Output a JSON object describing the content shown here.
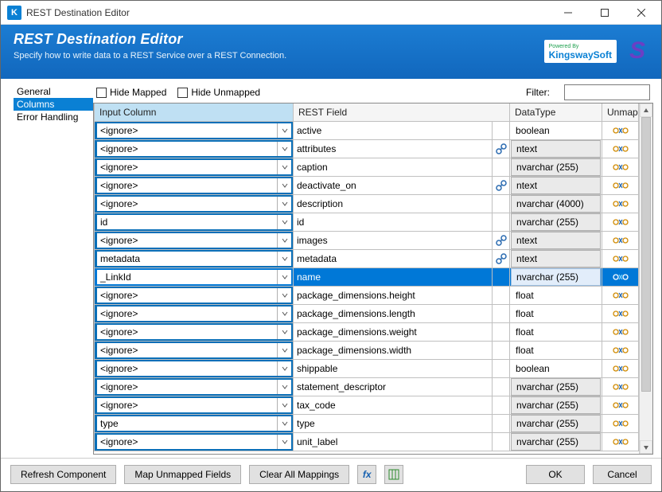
{
  "window": {
    "title": "REST Destination Editor"
  },
  "banner": {
    "heading": "REST Destination Editor",
    "subheading": "Specify how to write data to a REST Service over a REST Connection.",
    "powered_by_line1": "Powered By",
    "powered_by_line2": "KingswaySoft",
    "logo_s": "S"
  },
  "sidebar": {
    "items": [
      {
        "label": "General"
      },
      {
        "label": "Columns"
      },
      {
        "label": "Error Handling"
      }
    ],
    "selected_index": 1
  },
  "toolbar": {
    "hide_mapped": "Hide Mapped",
    "hide_unmapped": "Hide Unmapped",
    "filter_label": "Filter:"
  },
  "grid": {
    "headers": {
      "input": "Input Column",
      "rest": "REST Field",
      "datatype": "DataType",
      "unmap": "Unmap"
    },
    "rows": [
      {
        "input": "<ignore>",
        "rest": "active",
        "link": false,
        "datatype": "boolean",
        "dt_boxed": false
      },
      {
        "input": "<ignore>",
        "rest": "attributes",
        "link": true,
        "datatype": "ntext",
        "dt_boxed": true
      },
      {
        "input": "<ignore>",
        "rest": "caption",
        "link": false,
        "datatype": "nvarchar (255)",
        "dt_boxed": true
      },
      {
        "input": "<ignore>",
        "rest": "deactivate_on",
        "link": true,
        "datatype": "ntext",
        "dt_boxed": true
      },
      {
        "input": "<ignore>",
        "rest": "description",
        "link": false,
        "datatype": "nvarchar (4000)",
        "dt_boxed": true
      },
      {
        "input": "id",
        "rest": "id",
        "link": false,
        "datatype": "nvarchar (255)",
        "dt_boxed": true
      },
      {
        "input": "<ignore>",
        "rest": "images",
        "link": true,
        "datatype": "ntext",
        "dt_boxed": true
      },
      {
        "input": "metadata",
        "rest": "metadata",
        "link": true,
        "datatype": "ntext",
        "dt_boxed": true
      },
      {
        "input": "_LinkId",
        "rest": "name",
        "link": false,
        "datatype": "nvarchar (255)",
        "dt_boxed": true,
        "selected": true
      },
      {
        "input": "<ignore>",
        "rest": "package_dimensions.height",
        "link": false,
        "datatype": "float",
        "dt_boxed": false
      },
      {
        "input": "<ignore>",
        "rest": "package_dimensions.length",
        "link": false,
        "datatype": "float",
        "dt_boxed": false
      },
      {
        "input": "<ignore>",
        "rest": "package_dimensions.weight",
        "link": false,
        "datatype": "float",
        "dt_boxed": false
      },
      {
        "input": "<ignore>",
        "rest": "package_dimensions.width",
        "link": false,
        "datatype": "float",
        "dt_boxed": false
      },
      {
        "input": "<ignore>",
        "rest": "shippable",
        "link": false,
        "datatype": "boolean",
        "dt_boxed": false
      },
      {
        "input": "<ignore>",
        "rest": "statement_descriptor",
        "link": false,
        "datatype": "nvarchar (255)",
        "dt_boxed": true
      },
      {
        "input": "<ignore>",
        "rest": "tax_code",
        "link": false,
        "datatype": "nvarchar (255)",
        "dt_boxed": true
      },
      {
        "input": "type",
        "rest": "type",
        "link": false,
        "datatype": "nvarchar (255)",
        "dt_boxed": true
      },
      {
        "input": "<ignore>",
        "rest": "unit_label",
        "link": false,
        "datatype": "nvarchar (255)",
        "dt_boxed": true
      }
    ]
  },
  "footer": {
    "refresh": "Refresh Component",
    "map_unmapped": "Map Unmapped Fields",
    "clear_all": "Clear All Mappings",
    "ok": "OK",
    "cancel": "Cancel"
  }
}
